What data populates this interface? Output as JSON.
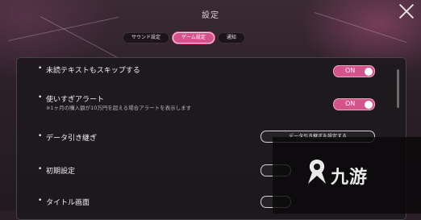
{
  "header": {
    "title": "設定"
  },
  "tabs": [
    {
      "label": "サウンド設定",
      "active": false
    },
    {
      "label": "ゲーム設定",
      "active": true
    },
    {
      "label": "通知",
      "active": false
    }
  ],
  "settings": [
    {
      "label": "未読テキストもスキップする",
      "control": "toggle",
      "value": "ON"
    },
    {
      "label": "使いすぎアラート",
      "sub": "※1ヶ月の購入額が10万円を超える場合アラートを表示します",
      "control": "toggle",
      "value": "ON"
    },
    {
      "label": "データ引き継ぎ",
      "control": "button",
      "button_label": "データ引き継ぎを設定する"
    },
    {
      "label": "初期設定",
      "control": "button",
      "button_label": ""
    },
    {
      "label": "タイトル画面",
      "control": "button",
      "button_label": ""
    }
  ],
  "watermark": {
    "text": "九游"
  },
  "colors": {
    "accent": "#d4538b",
    "panel": "#1c181c"
  },
  "icons": {
    "close": "close-icon",
    "watermark_logo": "jiuyou-logo"
  }
}
